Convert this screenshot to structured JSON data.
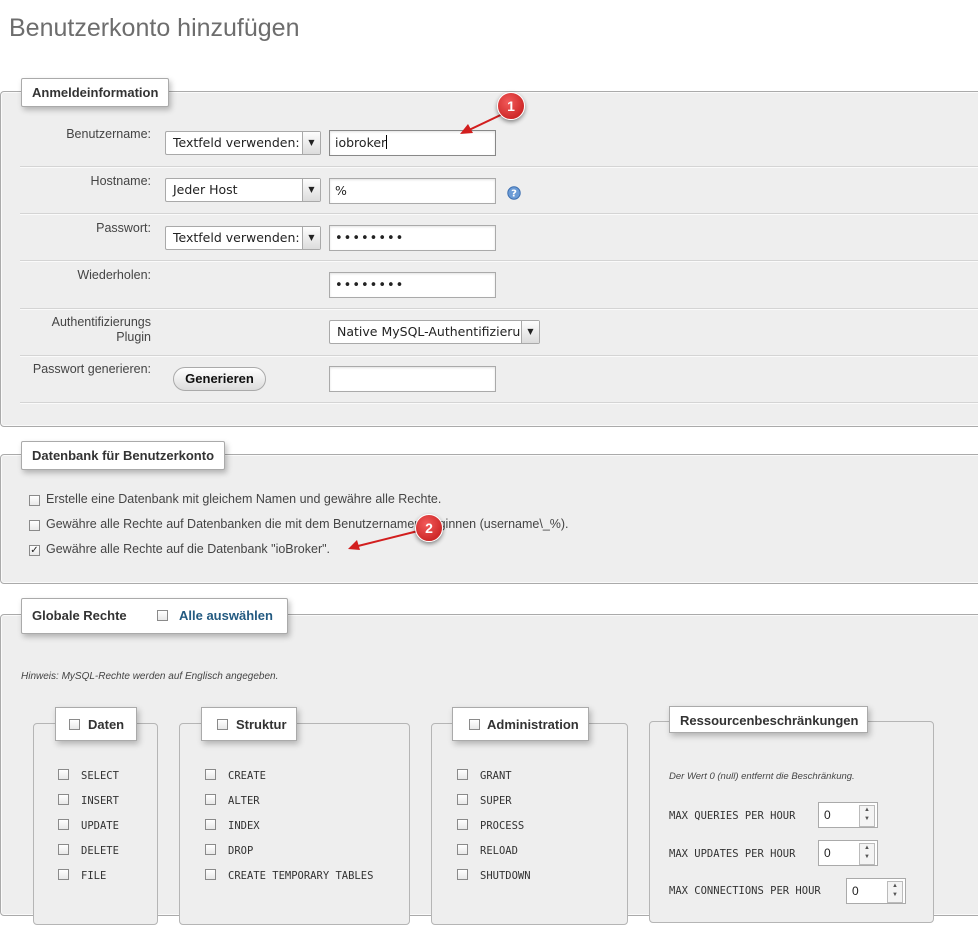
{
  "page": {
    "title": "Benutzerkonto hinzufügen"
  },
  "login": {
    "legend": "Anmeldeinformation",
    "username": {
      "label": "Benutzername:",
      "select": "Textfeld verwenden:",
      "value": "iobroker"
    },
    "hostname": {
      "label": "Hostname:",
      "select": "Jeder Host",
      "value": "%"
    },
    "password": {
      "label": "Passwort:",
      "select": "Textfeld verwenden:",
      "value": "••••••••"
    },
    "repeat": {
      "label": "Wiederholen:",
      "value": "••••••••"
    },
    "auth": {
      "label_line1": "Authentifizierungs",
      "label_line2": "Plugin",
      "select": "Native MySQL-Authentifizierung"
    },
    "generate": {
      "label": "Passwort generieren:",
      "button": "Generieren",
      "value": ""
    }
  },
  "database": {
    "legend": "Datenbank für Benutzerkonto",
    "options": [
      {
        "label": "Erstelle eine Datenbank mit gleichem Namen und gewähre alle Rechte.",
        "checked": false
      },
      {
        "label": "Gewähre alle Rechte auf Datenbanken die mit dem Benutzernamen beginnen (username\\_%).",
        "checked": false
      },
      {
        "label": "Gewähre alle Rechte auf die Datenbank \"ioBroker\".",
        "checked": true
      }
    ]
  },
  "global": {
    "legend": "Globale Rechte",
    "select_all": "Alle auswählen",
    "hint": "Hinweis: MySQL-Rechte werden auf Englisch angegeben.",
    "groups": {
      "data": {
        "title": "Daten",
        "items": [
          "SELECT",
          "INSERT",
          "UPDATE",
          "DELETE",
          "FILE"
        ]
      },
      "structure": {
        "title": "Struktur",
        "items": [
          "CREATE",
          "ALTER",
          "INDEX",
          "DROP",
          "CREATE TEMPORARY TABLES"
        ]
      },
      "admin": {
        "title": "Administration",
        "items": [
          "GRANT",
          "SUPER",
          "PROCESS",
          "RELOAD",
          "SHUTDOWN"
        ]
      }
    },
    "resources": {
      "title": "Ressourcenbeschränkungen",
      "hint": "Der Wert 0 (null) entfernt die Beschränkung.",
      "limits": [
        {
          "label": "MAX QUERIES PER HOUR",
          "value": "0"
        },
        {
          "label": "MAX UPDATES PER HOUR",
          "value": "0"
        },
        {
          "label": "MAX CONNECTIONS PER HOUR",
          "value": "0"
        }
      ]
    }
  },
  "annotations": {
    "marker1": "1",
    "marker2": "2"
  },
  "colors": {
    "marker": "#d21e1e",
    "link": "#235a81",
    "panel": "#eeeeee"
  }
}
